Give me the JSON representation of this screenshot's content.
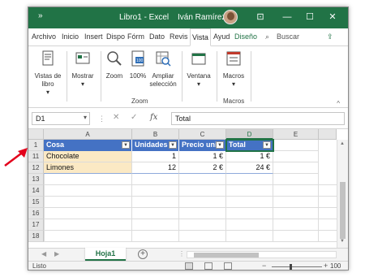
{
  "window": {
    "quick_access": "»",
    "title": "Libro1 - Excel",
    "user": "Iván Ramírez",
    "buttons": {
      "ribbon_display": "⊡",
      "minimize": "—",
      "maximize": "☐",
      "close": "✕"
    }
  },
  "menu_tabs": [
    {
      "label": "Archivo"
    },
    {
      "label": "Inicio"
    },
    {
      "label": "Insert"
    },
    {
      "label": "Dispo"
    },
    {
      "label": "Fórm"
    },
    {
      "label": "Dato"
    },
    {
      "label": "Revis"
    },
    {
      "label": "Vista",
      "active": true
    },
    {
      "label": "Ayud"
    },
    {
      "label": "Diseño"
    }
  ],
  "search_label": "Buscar",
  "ribbon": {
    "groups": [
      {
        "label": ""
      },
      {
        "label": "Zoom"
      },
      {
        "label": ""
      },
      {
        "label": "Macros"
      }
    ],
    "buttons": [
      {
        "label": "Vistas de libro",
        "caret": "▾"
      },
      {
        "label": "Mostrar",
        "caret": "▾"
      },
      {
        "label": "Zoom"
      },
      {
        "label": "100%"
      },
      {
        "label": "Ampliar selección"
      },
      {
        "label": "Ventana",
        "caret": "▾"
      },
      {
        "label": "Macros",
        "caret": "▾"
      }
    ]
  },
  "formula_bar": {
    "name_box": "D1",
    "fx_label": "fx",
    "formula": "Total"
  },
  "grid": {
    "columns": [
      "A",
      "B",
      "C",
      "D",
      "E"
    ],
    "selected_column": "D",
    "row_numbers": [
      "1",
      "11",
      "12",
      "13",
      "14",
      "15",
      "16",
      "17",
      "18"
    ],
    "table_headers": [
      "Cosa",
      "Unidades",
      "Precio uni",
      "Total"
    ],
    "rows": [
      {
        "cosa": "Chocolate",
        "unidades": "1",
        "precio": "1 €",
        "total": "1 €"
      },
      {
        "cosa": "Limones",
        "unidades": "12",
        "precio": "2 €",
        "total": "24 €"
      }
    ]
  },
  "sheet_tabs": [
    {
      "label": "Hoja1",
      "active": true
    }
  ],
  "status_bar": {
    "ready": "Listo",
    "zoom": "100 %"
  },
  "colors": {
    "excel_green": "#217346",
    "table_header": "#4472c4",
    "band": "#fbe9c4",
    "arrow": "#e3001b"
  }
}
